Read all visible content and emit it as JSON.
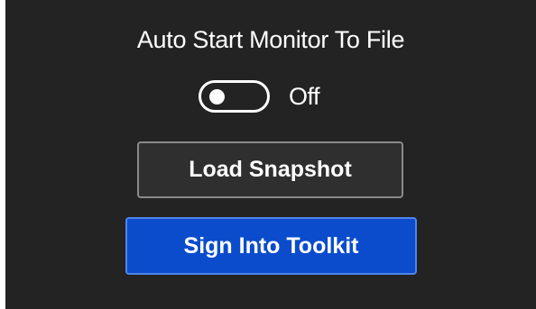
{
  "settings": {
    "auto_start_label": "Auto Start Monitor To File",
    "toggle_state": "Off",
    "toggle_on": false
  },
  "actions": {
    "load_snapshot_label": "Load Snapshot",
    "sign_in_label": "Sign Into Toolkit"
  },
  "colors": {
    "background": "#232323",
    "primary_button": "#0a4ccc",
    "secondary_button": "#2f2f2f"
  }
}
